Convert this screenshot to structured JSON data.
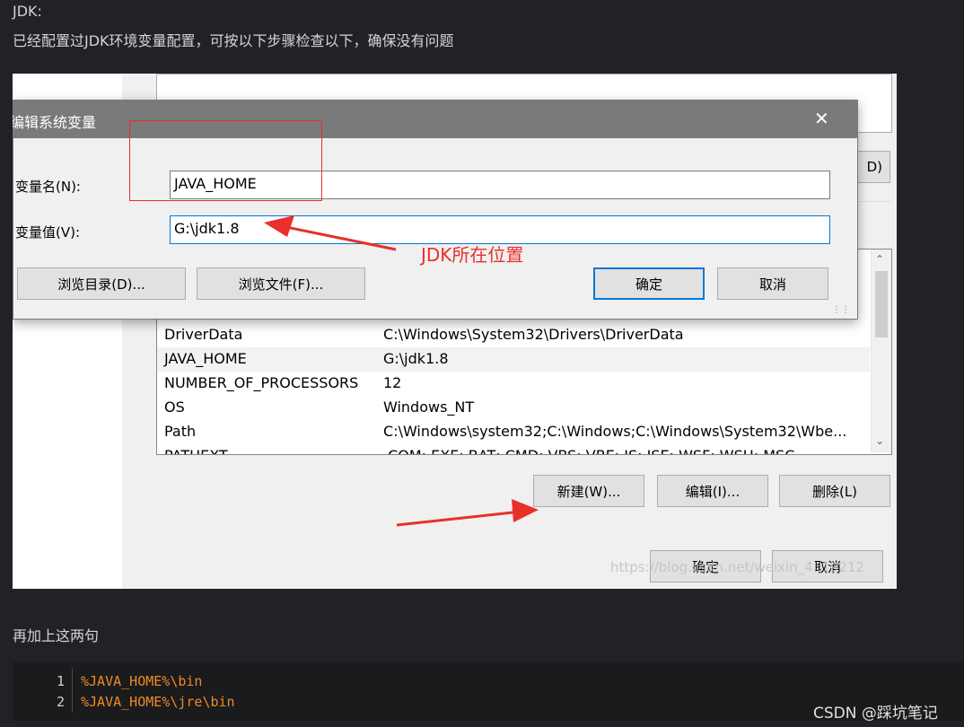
{
  "article": {
    "heading": "JDK:",
    "intro": "已经配置过JDK环境变量配置，可按以下步骤检查以下，确保没有问题",
    "after_text": "再加上这两句"
  },
  "dialog": {
    "title": "编辑系统变量",
    "name_label": "变量名(N):",
    "name_value": "JAVA_HOME",
    "value_label": "变量值(V):",
    "value_value": "G:\\jdk1.8",
    "browse_dir": "浏览目录(D)...",
    "browse_file": "浏览文件(F)...",
    "ok": "确定",
    "cancel": "取消"
  },
  "background_window": {
    "top_button_fragment": "D)",
    "variables": [
      {
        "name": "DriverData",
        "value": "C:\\Windows\\System32\\Drivers\\DriverData"
      },
      {
        "name": "JAVA_HOME",
        "value": "G:\\jdk1.8"
      },
      {
        "name": "NUMBER_OF_PROCESSORS",
        "value": "12"
      },
      {
        "name": "OS",
        "value": "Windows_NT"
      },
      {
        "name": "Path",
        "value": "C:\\Windows\\system32;C:\\Windows;C:\\Windows\\System32\\Wbe..."
      },
      {
        "name": "PATHEXT",
        "value": ".COM;.EXE;.BAT;.CMD;.VBS;.VBE;.JS;.JSE;.WSF;.WSH;.MSC"
      }
    ],
    "new_button": "新建(W)...",
    "edit_button": "编辑(I)...",
    "delete_button": "删除(L)",
    "ok": "确定",
    "cancel": "取消",
    "watermark": "https://blog.csdn.net/weixin_4..19212"
  },
  "annotation": {
    "label": "JDK所在位置",
    "color": "#e8302a"
  },
  "code": {
    "lines": [
      {
        "num": "1",
        "text": "%JAVA_HOME%\\bin"
      },
      {
        "num": "2",
        "text": "%JAVA_HOME%\\jre\\bin"
      }
    ]
  },
  "footer": {
    "watermark": "CSDN @踩坑笔记"
  }
}
